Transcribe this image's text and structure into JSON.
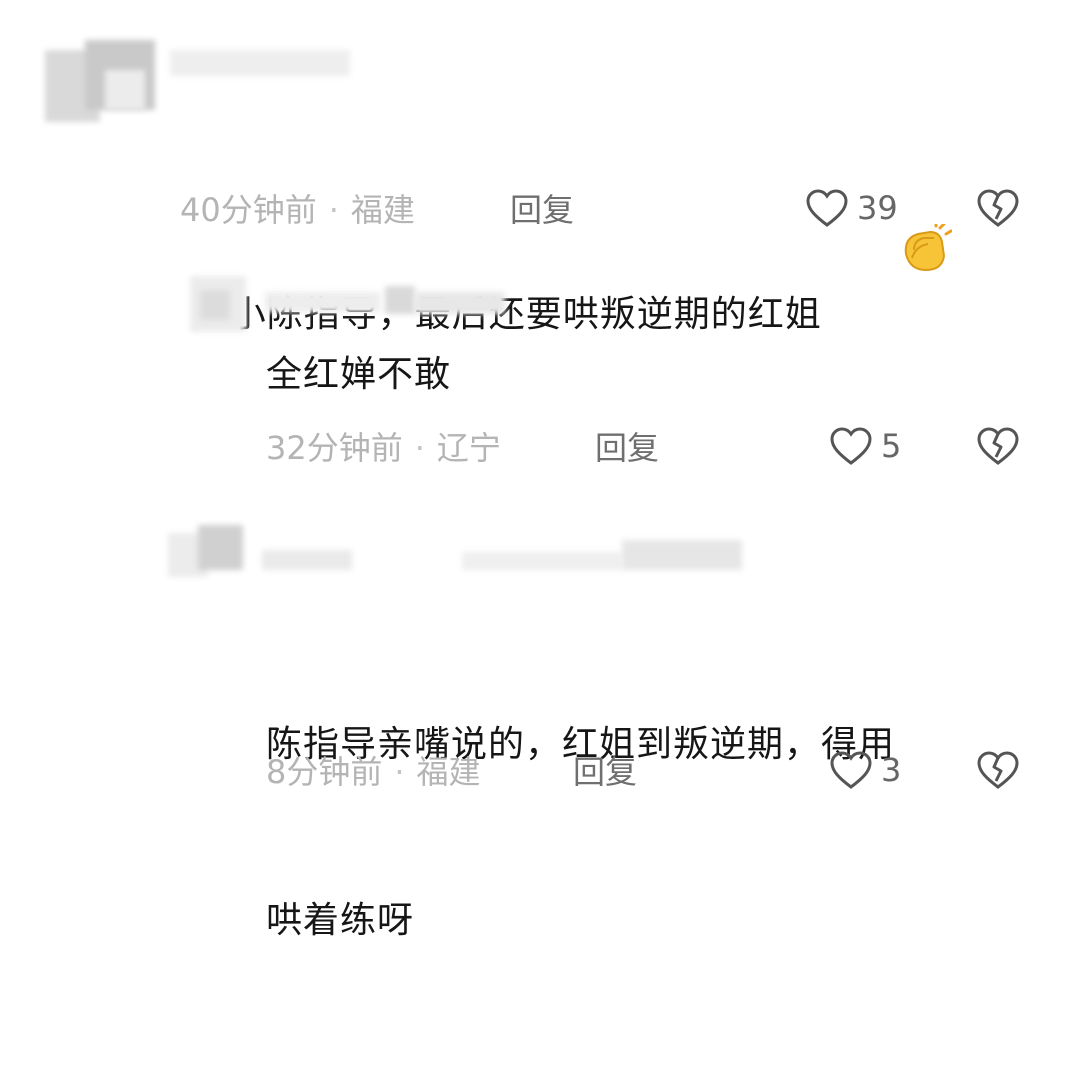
{
  "comments": [
    {
      "text": "小陈指导，最后还要哄叛逆期的红姐",
      "emoji": "clapping-hands-emoji",
      "time": "40分钟前",
      "location": "福建",
      "reply": "回复",
      "likes": "39"
    },
    {
      "text": "全红婵不敢",
      "time": "32分钟前",
      "location": "辽宁",
      "reply": "回复",
      "likes": "5"
    },
    {
      "text_line1": "陈指导亲嘴说的，红姐到叛逆期，得用",
      "text_line2": "哄着练呀",
      "time": "8分钟前",
      "location": "福建",
      "reply": "回复",
      "likes": "3"
    }
  ],
  "meta_separator": "·",
  "icons": {
    "like": "heart-outline-icon",
    "dislike": "broken-heart-icon"
  },
  "colors": {
    "text": "#161616",
    "meta": "#b4b4b4",
    "reply": "#6f6f6f",
    "icon": "#555555"
  }
}
